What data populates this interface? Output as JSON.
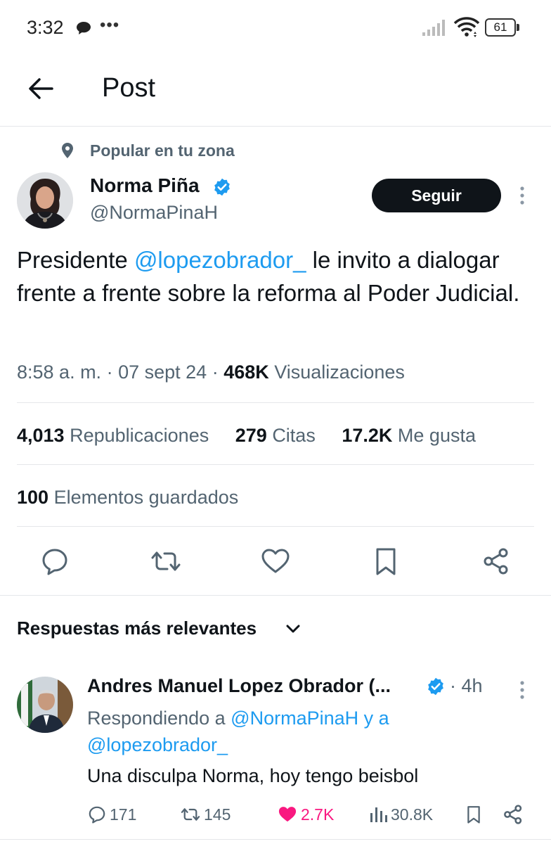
{
  "status_bar": {
    "time": "3:32",
    "dots": "•••",
    "battery": "61",
    "icons": [
      "message-icon",
      "signal-icon",
      "wifi-icon",
      "battery-icon"
    ]
  },
  "header": {
    "title": "Post"
  },
  "post": {
    "context": "Popular en tu zona",
    "author_name": "Norma Piña",
    "author_handle": "@NormaPinaH",
    "follow_label": "Seguir",
    "text_pre": "Presidente ",
    "text_mention": "@lopezobrador_",
    "text_post": " le invito a dialogar frente a frente sobre la reforma al Poder Judicial.",
    "time": "8:58 a. m.",
    "date": "07 sept 24",
    "views_count": "468K",
    "views_label": "Visualizaciones",
    "reposts_count": "4,013",
    "reposts_label": "Republicaciones",
    "quotes_count": "279",
    "quotes_label": "Citas",
    "likes_count": "17.2K",
    "likes_label": "Me gusta",
    "bookmarks_count": "100",
    "bookmarks_label": "Elementos guardados"
  },
  "replies": {
    "sort_label": "Respuestas más relevantes",
    "items": [
      {
        "author_name": "Andres Manuel Lopez Obrador (...",
        "time": "4h",
        "replying_prefix": "Respondiendo a ",
        "replying_to_1": "@NormaPinaH",
        "replying_and": " y a",
        "replying_to_2": "@lopezobrador_",
        "text": "Una disculpa Norma, hoy tengo beisbol",
        "replies_count": "171",
        "reposts_count": "145",
        "likes_count": "2.7K",
        "views_count": "30.8K"
      }
    ]
  },
  "colors": {
    "accent": "#1d9bf0",
    "text": "#0f1419",
    "secondary": "#536471",
    "like": "#f91880"
  }
}
